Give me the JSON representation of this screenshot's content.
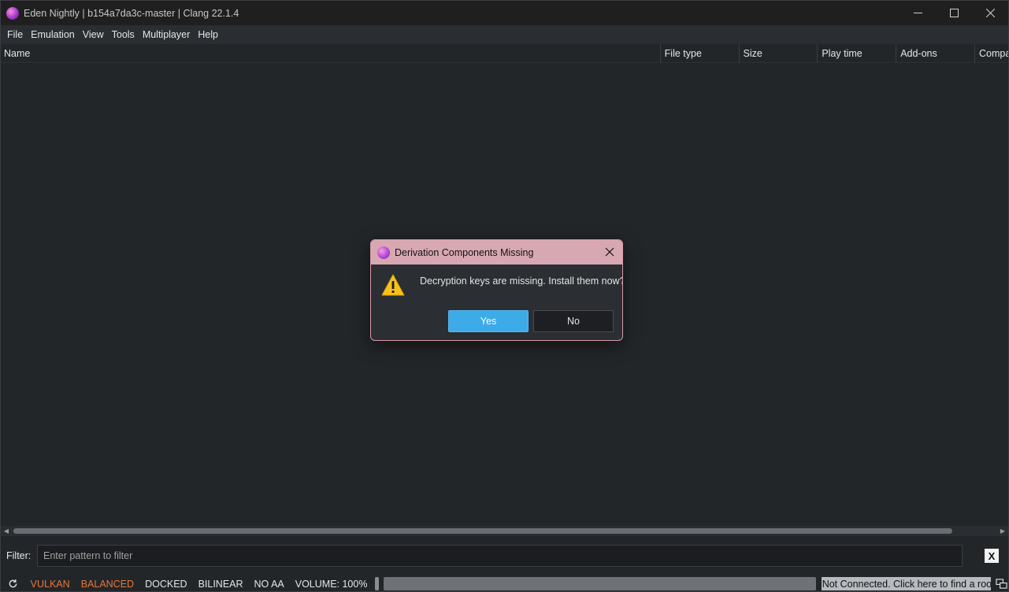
{
  "window": {
    "title": "Eden Nightly | b154a7da3c-master | Clang 22.1.4",
    "controls": [
      "minimize-icon",
      "maximize-icon",
      "close-icon"
    ]
  },
  "menu": {
    "items": [
      "File",
      "Emulation",
      "View",
      "Tools",
      "Multiplayer",
      "Help"
    ]
  },
  "game_list": {
    "columns": [
      "Name",
      "File type",
      "Size",
      "Play time",
      "Add-ons",
      "Compa"
    ],
    "rows": []
  },
  "filter": {
    "label": "Filter:",
    "value": "",
    "placeholder": "Enter pattern to filter",
    "clear_label": "X"
  },
  "statusbar": {
    "renderer": "VULKAN",
    "gpu_accuracy": "BALANCED",
    "dock_mode": "DOCKED",
    "filter_mode": "BILINEAR",
    "anti_aliasing": "NO AA",
    "volume": "VOLUME: 100%",
    "room_status": "Not Connected. Click here to find a room!",
    "accent_color": "#e8763a"
  },
  "dialog": {
    "title": "Derivation Components Missing",
    "message": "Decryption keys are missing. Install them now?",
    "icon": "warning-icon",
    "yes_label": "Yes",
    "no_label": "No",
    "primary_color": "#3cabe8"
  }
}
